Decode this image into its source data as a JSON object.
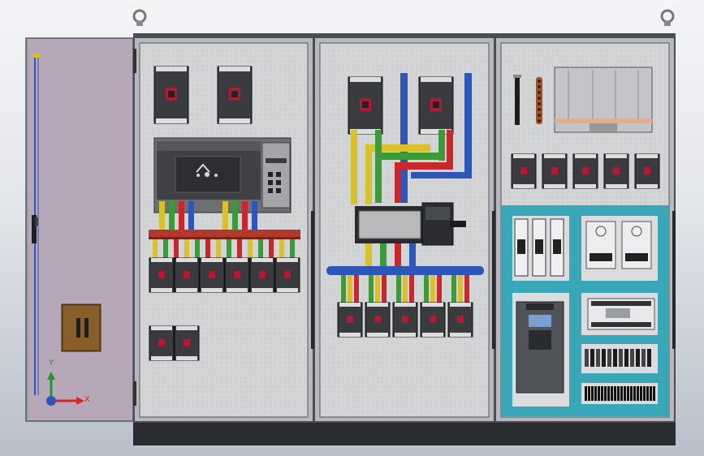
{
  "colors": {
    "door": "#b6a8b8",
    "cabinet_frame": "#4a4e54",
    "panel": "#cfcfd1",
    "cabinet_plinth": "#2b2c2f",
    "bus_yellow": "#d8c12a",
    "bus_green": "#3c9a3a",
    "bus_red": "#c8282c",
    "bus_blue": "#2e55b8",
    "bus_copper": "#c98a3e",
    "din_zone": "#39a7b8",
    "breaker_body": "#3a3b3e",
    "breaker_red": "#b21a32",
    "vfd_body": "#505459",
    "vfd_screen": "#7c9fd0"
  },
  "triad": {
    "x_label": "X",
    "y_label": "Y"
  },
  "icons": {
    "lifting_eye_left": "lifting-eye-icon",
    "lifting_eye_right": "lifting-eye-icon",
    "ats_symbol": "transfer-switch-icon"
  }
}
